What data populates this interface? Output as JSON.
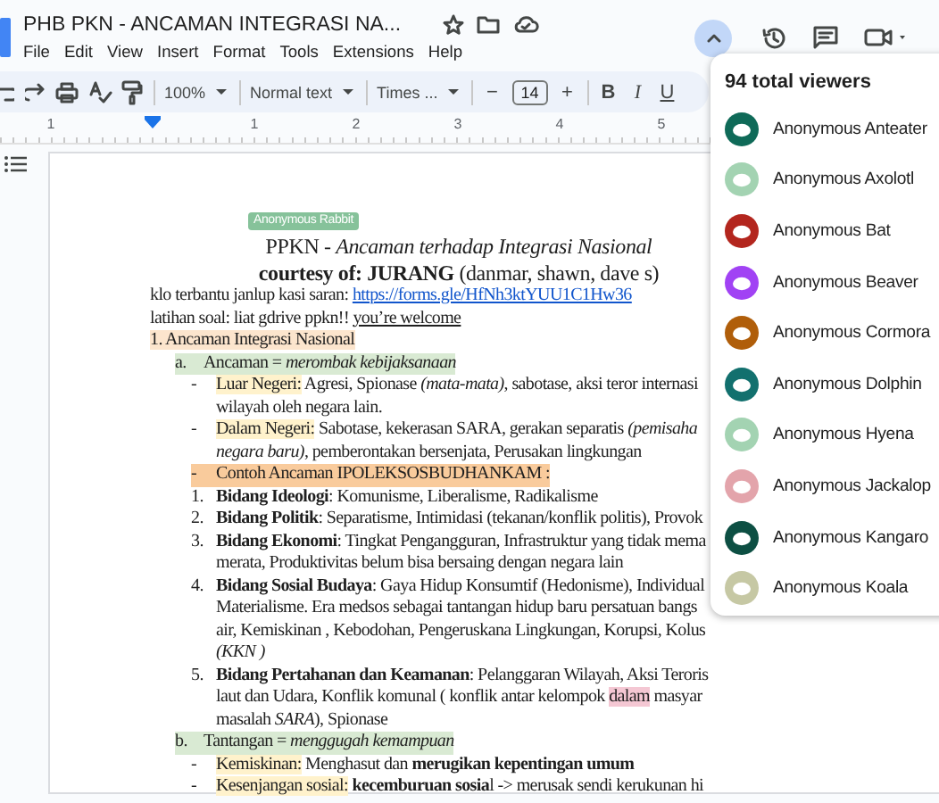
{
  "title_bar": {
    "title": "PHB PKN - ANCAMAN INTEGRASI NA...",
    "menu": [
      "File",
      "Edit",
      "View",
      "Insert",
      "Format",
      "Tools",
      "Extensions",
      "Help"
    ]
  },
  "toolbar": {
    "zoom": "100%",
    "style": "Normal text",
    "font": "Times ...",
    "font_size": "14",
    "minus": "−",
    "plus": "+",
    "bold": "B",
    "italic": "I",
    "underline": "U"
  },
  "ruler": {
    "labels": [
      "1",
      "1",
      "2",
      "3",
      "4",
      "5"
    ]
  },
  "document": {
    "cursor_label": "Anonymous Rabbit",
    "lines": [
      {
        "kind": "title",
        "parts": [
          {
            "kind": "text",
            "text": "PPKN - *Ancaman terhadap Integrasi Nasional*"
          }
        ]
      },
      {
        "kind": "title",
        "parts": [
          {
            "kind": "text",
            "text": "**courtesy of: JURANG** (danmar, shawn, dave s)"
          }
        ]
      },
      {
        "kind": "plain",
        "parts": [
          {
            "kind": "text",
            "text": "klo terbantu janlup kasi saran: "
          },
          {
            "kind": "link",
            "text": "https://forms.gle/HfNh3ktYUU1C1Hw36"
          }
        ]
      },
      {
        "kind": "plain",
        "parts": [
          {
            "kind": "text",
            "text": "latihan soal: liat gdrive ppkn!! "
          },
          {
            "kind": "underline",
            "text": "you’re welcome"
          }
        ]
      },
      {
        "kind": "plain",
        "parts": [
          {
            "kind": "text",
            "text": "1. Ancaman Integrasi Nasional",
            "color": "#fce5cd"
          }
        ]
      },
      {
        "kind": "level1",
        "marker": "a.",
        "color": "#d9ead3",
        "parts": [
          {
            "kind": "text",
            "text": "Ancaman = *merombak kebijaksanaan*"
          }
        ]
      },
      {
        "kind": "level2",
        "marker": "-",
        "parts": [
          {
            "kind": "text",
            "text": "Luar Negeri:",
            "color": "#fff2cc"
          },
          {
            "kind": "text",
            "text": " Agresi, Spionase *(mata-mata)*, sabotase, aksi teror internasi"
          }
        ]
      },
      {
        "kind": "cont",
        "parts": [
          {
            "kind": "text",
            "text": "wilayah oleh negara lain."
          }
        ]
      },
      {
        "kind": "level2",
        "marker": "-",
        "parts": [
          {
            "kind": "text",
            "text": "Dalam Negeri:",
            "color": "#fff2cc"
          },
          {
            "kind": "text",
            "text": " Sabotase, kekerasan SARA, gerakan separatis *(pemisaha*"
          }
        ]
      },
      {
        "kind": "cont",
        "parts": [
          {
            "kind": "text",
            "text": "*negara baru)*, pemberontakan bersenjata, Perusakan lingkungan"
          }
        ]
      },
      {
        "kind": "level2",
        "marker": "-",
        "color": "#f9cb9c",
        "parts": [
          {
            "kind": "text",
            "text": "Contoh Ancaman IPOLEKSOSBUDHANKAM :"
          }
        ]
      },
      {
        "kind": "level2",
        "marker": "1.",
        "parts": [
          {
            "kind": "text",
            "text": "**Bidang Ideologi**: Komunisme, Liberalisme, Radikalisme"
          }
        ]
      },
      {
        "kind": "level2",
        "marker": "2.",
        "parts": [
          {
            "kind": "text",
            "text": "**Bidang Politik**: Separatisme, Intimidasi (tekanan/konflik politis), Provok"
          }
        ]
      },
      {
        "kind": "level2",
        "marker": "3.",
        "parts": [
          {
            "kind": "text",
            "text": "**Bidang Ekonomi**: Tingkat Pengangguran, Infrastruktur yang tidak mema"
          }
        ]
      },
      {
        "kind": "cont",
        "parts": [
          {
            "kind": "text",
            "text": "merata, Produktivitas belum bisa bersaing dengan negara lain"
          }
        ]
      },
      {
        "kind": "level2",
        "marker": "4.",
        "parts": [
          {
            "kind": "text",
            "text": "**Bidang Sosial Budaya**: Gaya Hidup Konsumtif (Hedonisme), Individual"
          }
        ]
      },
      {
        "kind": "cont",
        "parts": [
          {
            "kind": "text",
            "text": "Materialisme. Era medsos sebagai tantangan hidup baru persatuan bangs"
          }
        ]
      },
      {
        "kind": "cont",
        "parts": [
          {
            "kind": "text",
            "text": "air, Kemiskinan , Kebodohan, Pengeruskana Lingkungan, Korupsi, Kolus"
          }
        ]
      },
      {
        "kind": "cont",
        "parts": [
          {
            "kind": "text",
            "text": "*(KKN )*"
          }
        ]
      },
      {
        "kind": "level2",
        "marker": "5.",
        "parts": [
          {
            "kind": "text",
            "text": "**Bidang Pertahanan dan Keamanan**: Pelanggaran Wilayah, Aksi Teroris"
          }
        ]
      },
      {
        "kind": "cont",
        "parts": [
          {
            "kind": "text",
            "text": "laut dan Udara, Konflik komunal ( konflik antar kelompok "
          },
          {
            "kind": "text",
            "text": "dalam",
            "color": "#f4c7d3"
          },
          {
            "kind": "text",
            "text": " masyar"
          }
        ]
      },
      {
        "kind": "cont",
        "parts": [
          {
            "kind": "text",
            "text": "masalah *SARA*), Spionase"
          }
        ]
      },
      {
        "kind": "level1",
        "marker": "b.",
        "color": "#d9ead3",
        "parts": [
          {
            "kind": "text",
            "text": "Tantangan = *menggugah kemampuan*"
          }
        ]
      },
      {
        "kind": "level2",
        "marker": "-",
        "parts": [
          {
            "kind": "text",
            "text": "Kemiskinan:",
            "color": "#fff2cc"
          },
          {
            "kind": "text",
            "text": " Menghasut dan **merugikan kepentingan umum**"
          }
        ]
      },
      {
        "kind": "level2",
        "marker": "-",
        "parts": [
          {
            "kind": "text",
            "text": "Kesenjangan sosial:",
            "color": "#fff2cc"
          },
          {
            "kind": "text",
            "text": " **kecemburuan sosia**l -> merusak sendi kerukunan hi"
          }
        ]
      }
    ]
  },
  "viewers_panel": {
    "heading": "94 total viewers",
    "viewers": [
      {
        "name": "Anonymous Anteater",
        "color": "#0f6a58"
      },
      {
        "name": "Anonymous Axolotl",
        "color": "#a3d3b2"
      },
      {
        "name": "Anonymous Bat",
        "color": "#b3261e"
      },
      {
        "name": "Anonymous Beaver",
        "color": "#a142f4"
      },
      {
        "name": "Anonymous Cormora",
        "color": "#b05e0a"
      },
      {
        "name": "Anonymous Dolphin",
        "color": "#12706e"
      },
      {
        "name": "Anonymous Hyena",
        "color": "#a3d3b2"
      },
      {
        "name": "Anonymous Jackalop",
        "color": "#e3a4ab"
      },
      {
        "name": "Anonymous Kangaro",
        "color": "#0d4f43"
      },
      {
        "name": "Anonymous Koala",
        "color": "#c6c8a4"
      }
    ]
  }
}
